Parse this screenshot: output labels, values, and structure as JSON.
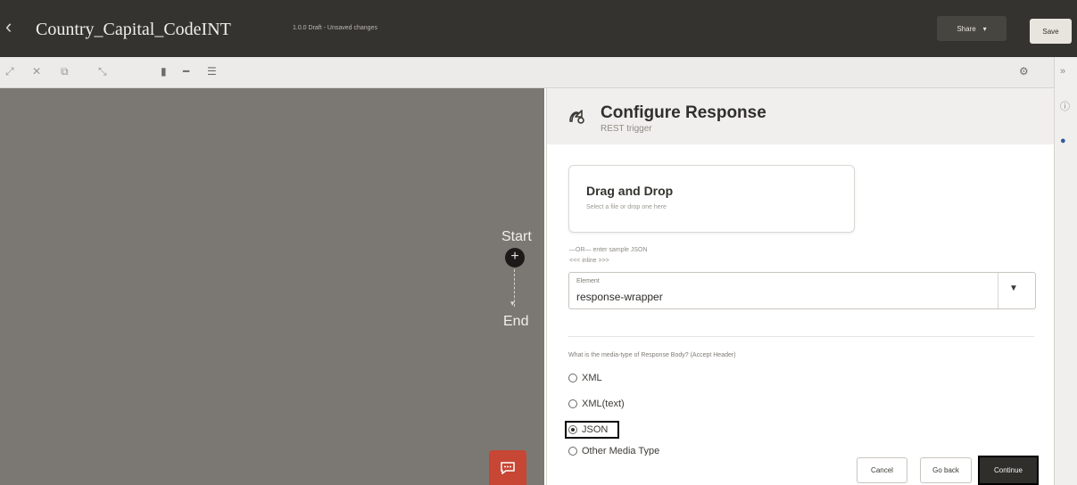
{
  "header": {
    "back_icon": "chevron-left-icon",
    "app_name": "Country_Capital_CodeINT",
    "status": "1.0.0 Draft - Unsaved changes",
    "share_label": "Share",
    "save_label": "Save"
  },
  "toolbar": {
    "icons": [
      "expand-icon",
      "cut-icon",
      "copy-icon",
      "collapse-icon",
      "vertical-layout-icon",
      "horizontal-layout-icon",
      "tree-layout-icon",
      "settings-icon"
    ]
  },
  "canvas": {
    "start_label": "Start",
    "end_label": "End",
    "chat_icon": "chat-icon"
  },
  "panel": {
    "title": "Configure Response",
    "subtitle": "REST trigger",
    "dropzone_title": "Drag and Drop",
    "dropzone_subtitle": "Select a file or drop one here",
    "or_text": "—OR— enter sample JSON",
    "inline_text": "<<< inline >>>",
    "element_label": "Element",
    "element_value": "response-wrapper",
    "question": "What is the media-type of Response Body? (Accept Header)",
    "radios": [
      {
        "label": "XML",
        "checked": false
      },
      {
        "label": "XML(text)",
        "checked": false
      },
      {
        "label": "JSON",
        "checked": true
      },
      {
        "label": "Other Media Type",
        "checked": false
      }
    ],
    "cancel_label": "Cancel",
    "goback_label": "Go back",
    "continue_label": "Continue"
  },
  "colors": {
    "topbar": "#343330",
    "canvas": "#7b7873",
    "accent_red": "#c74634",
    "continue_bg": "#2f2e2b"
  }
}
